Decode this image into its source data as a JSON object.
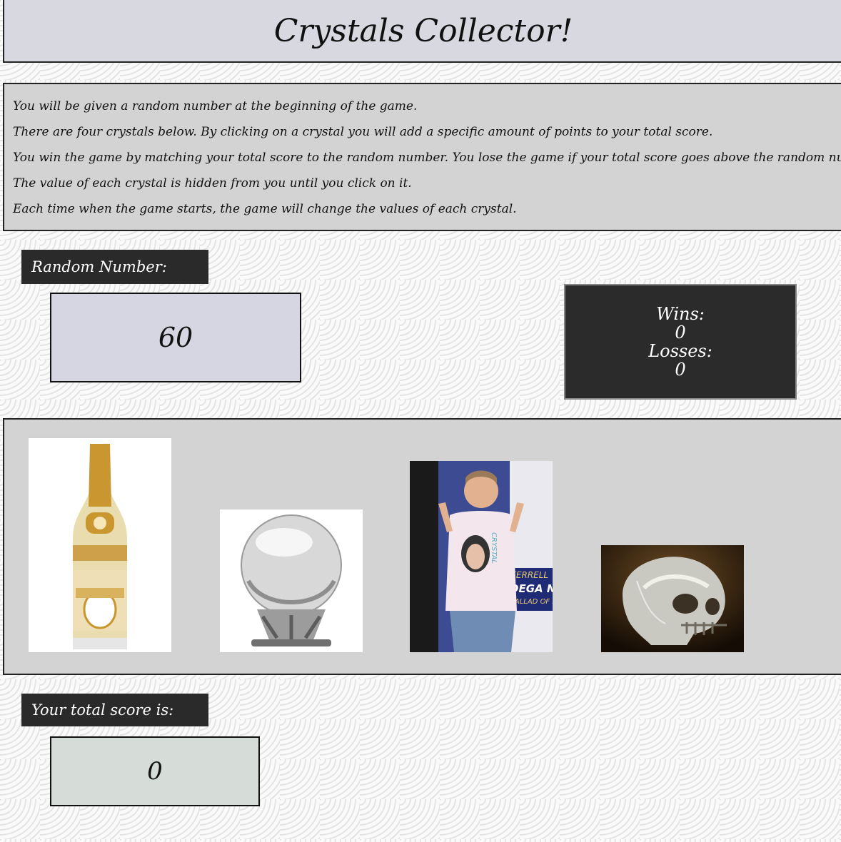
{
  "header": {
    "title": "Crystals Collector!"
  },
  "instructions": [
    "You will be given a random number at the beginning of the game.",
    "There are four crystals below. By clicking on a crystal you will add a specific amount of points to your total score.",
    "You win the game by matching your total score to the random number. You lose the game if your total score goes above the random number.",
    "The value of each crystal is hidden from you until you click on it.",
    "Each time when the game starts, the game will change the values of each crystal."
  ],
  "random": {
    "label": "Random Number:",
    "value": "60"
  },
  "scoreboard": {
    "wins_label": "Wins:",
    "wins": "0",
    "losses_label": "Losses:",
    "losses": "0"
  },
  "crystals": [
    {
      "icon": "champagne-bottle-image"
    },
    {
      "icon": "crystal-ball-image"
    },
    {
      "icon": "person-crystal-shirt-image",
      "shirt_text": "CRYSTAL",
      "poster_text": "FERRELL",
      "poster_text2": "DEGA N",
      "poster_text3": "BALLAD OF RI"
    },
    {
      "icon": "crystal-skull-image"
    }
  ],
  "total": {
    "label": "Your total score is:",
    "value": "0"
  }
}
